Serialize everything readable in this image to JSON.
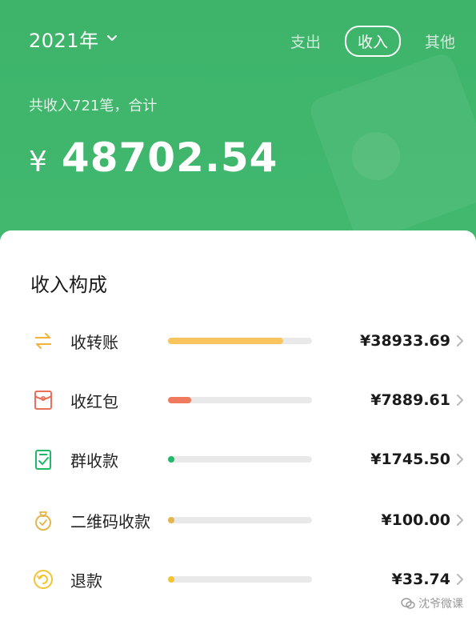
{
  "header": {
    "year": "2021年",
    "tabs": [
      "支出",
      "收入",
      "其他"
    ],
    "active_tab": "收入",
    "summary": "共收入721笔，合计",
    "currency": "¥",
    "total": "48702.54"
  },
  "card": {
    "title": "收入构成",
    "items": [
      {
        "label": "收转账",
        "value": "¥38933.69",
        "icon": "transfer-icon",
        "color": "#f9c55c",
        "fraction": 0.8
      },
      {
        "label": "收红包",
        "value": "¥7889.61",
        "icon": "red-packet-icon",
        "color": "#f07a5e",
        "fraction": 0.16
      },
      {
        "label": "群收款",
        "value": "¥1745.50",
        "icon": "group-collection-icon",
        "color": "#20b96a",
        "fraction": 0.036
      },
      {
        "label": "二维码收款",
        "value": "¥100.00",
        "icon": "qr-money-bag-icon",
        "color": "#e3b54d",
        "fraction": 0.002
      },
      {
        "label": "退款",
        "value": "¥33.74",
        "icon": "refund-icon",
        "color": "#f4c430",
        "fraction": 0.001
      }
    ]
  },
  "watermark": "沈爷微课"
}
